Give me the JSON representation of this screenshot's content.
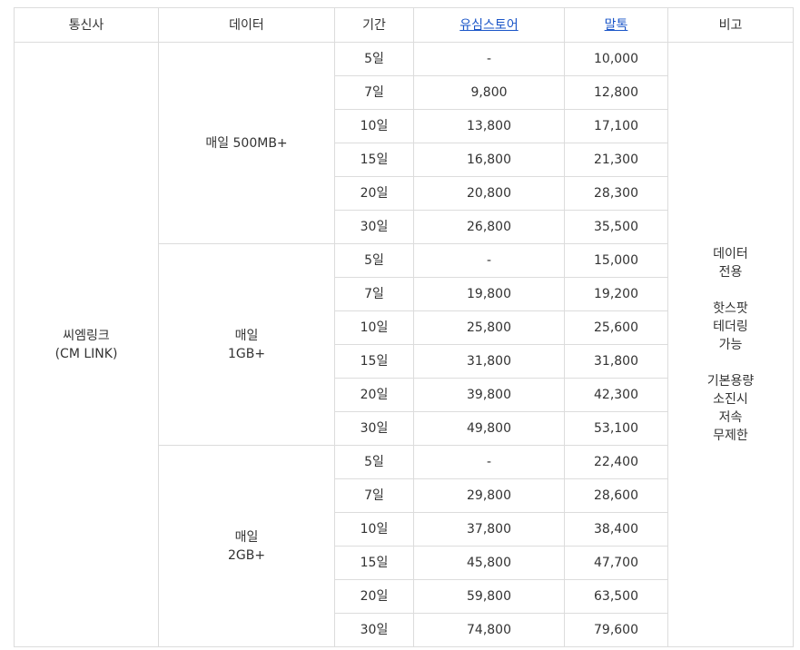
{
  "headers": {
    "carrier": "통신사",
    "data": "데이터",
    "period": "기간",
    "store1": "유심스토어",
    "store2": "말톡",
    "note": "비고"
  },
  "carrier": "씨엠링크\n(CM LINK)",
  "note": "데이터\n전용\n\n핫스팟\n테더링\n가능\n\n기본용량\n소진시\n저속\n무제한",
  "plans": [
    {
      "label": "매일 500MB+",
      "rows": [
        {
          "period": "5일",
          "store1": "-",
          "store2": "10,000"
        },
        {
          "period": "7일",
          "store1": "9,800",
          "store2": "12,800"
        },
        {
          "period": "10일",
          "store1": "13,800",
          "store2": "17,100"
        },
        {
          "period": "15일",
          "store1": "16,800",
          "store2": "21,300"
        },
        {
          "period": "20일",
          "store1": "20,800",
          "store2": "28,300"
        },
        {
          "period": "30일",
          "store1": "26,800",
          "store2": "35,500"
        }
      ]
    },
    {
      "label": "매일\n1GB+",
      "rows": [
        {
          "period": "5일",
          "store1": "-",
          "store2": "15,000"
        },
        {
          "period": "7일",
          "store1": "19,800",
          "store2": "19,200"
        },
        {
          "period": "10일",
          "store1": "25,800",
          "store2": "25,600"
        },
        {
          "period": "15일",
          "store1": "31,800",
          "store2": "31,800"
        },
        {
          "period": "20일",
          "store1": "39,800",
          "store2": "42,300"
        },
        {
          "period": "30일",
          "store1": "49,800",
          "store2": "53,100"
        }
      ]
    },
    {
      "label": "매일\n2GB+",
      "rows": [
        {
          "period": "5일",
          "store1": "-",
          "store2": "22,400"
        },
        {
          "period": "7일",
          "store1": "29,800",
          "store2": "28,600"
        },
        {
          "period": "10일",
          "store1": "37,800",
          "store2": "38,400"
        },
        {
          "period": "15일",
          "store1": "45,800",
          "store2": "47,700"
        },
        {
          "period": "20일",
          "store1": "59,800",
          "store2": "63,500"
        },
        {
          "period": "30일",
          "store1": "74,800",
          "store2": "79,600"
        }
      ]
    }
  ],
  "colors": {
    "border": "#dcdcdc",
    "text": "#333333",
    "link": "#1a55c8"
  }
}
